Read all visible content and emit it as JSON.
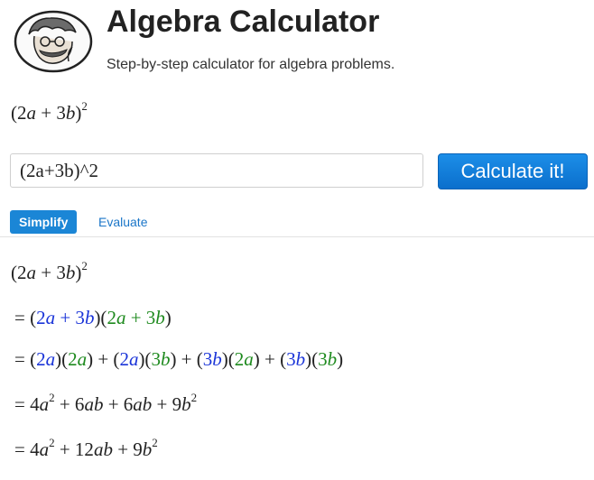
{
  "header": {
    "title": "Algebra Calculator",
    "subtitle": "Step-by-step calculator for algebra problems."
  },
  "input": {
    "value": "(2a+3b)^2"
  },
  "calculate_button": {
    "label": "Calculate it!"
  },
  "tabs": [
    {
      "label": "Simplify",
      "active": true
    },
    {
      "label": "Evaluate",
      "active": false
    }
  ],
  "colors": {
    "accent_blue": "#1b86d6",
    "term_blue": "#1a34d8",
    "term_green": "#1e8a1e"
  },
  "preview_expression": "(2a + 3b)^2",
  "steps": [
    "(2a + 3b)^2",
    "= (2a + 3b)(2a + 3b)",
    "= (2a)(2a) + (2a)(3b) + (3b)(2a) + (3b)(3b)",
    "= 4a^2 + 6ab + 6ab + 9b^2",
    "= 4a^2 + 12ab + 9b^2"
  ]
}
